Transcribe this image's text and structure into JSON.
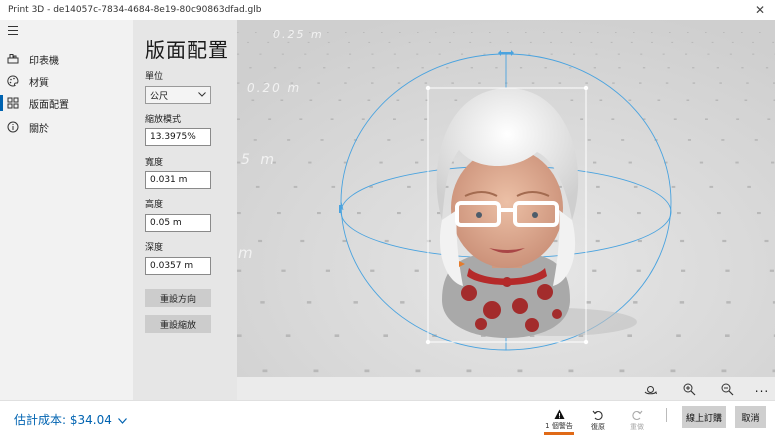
{
  "window": {
    "title": "Print 3D - de14057c-7834-4684-8e19-80c90863dfad.glb"
  },
  "nav": {
    "items": [
      {
        "label": "印表機",
        "icon": "printer-icon"
      },
      {
        "label": "材質",
        "icon": "palette-icon"
      },
      {
        "label": "版面配置",
        "icon": "layout-icon",
        "active": true
      },
      {
        "label": "關於",
        "icon": "info-icon"
      }
    ]
  },
  "panel": {
    "title": "版面配置",
    "unit_label": "單位",
    "unit_value": "公尺",
    "scale_label": "縮放模式",
    "scale_value": "13.3975%",
    "width_label": "寬度",
    "width_value": "0.031 m",
    "height_label": "高度",
    "height_value": "0.05 m",
    "depth_label": "深度",
    "depth_value": "0.0357 m",
    "reset_orientation": "重設方向",
    "reset_scale": "重設縮放"
  },
  "viewport": {
    "grid_labels": [
      "0.25 m",
      "0.20 m",
      "5 m",
      "m"
    ],
    "colors": {
      "background": "#d4d4d4",
      "gizmo": "#4aa3df",
      "bbox": "#ffffff"
    }
  },
  "view_toolbar": {
    "icons": [
      "view-3d-icon",
      "zoom-in-icon",
      "zoom-out-icon",
      "more-icon"
    ],
    "more": "..."
  },
  "bottom": {
    "cost": "估計成本: $34.04",
    "warning_label": "1 個警告",
    "undo_label": "復原",
    "redo_label": "重做",
    "order_label": "線上訂購",
    "cancel_label": "取消",
    "accent_color": "#0063b1",
    "warning_color": "#e06a17"
  }
}
